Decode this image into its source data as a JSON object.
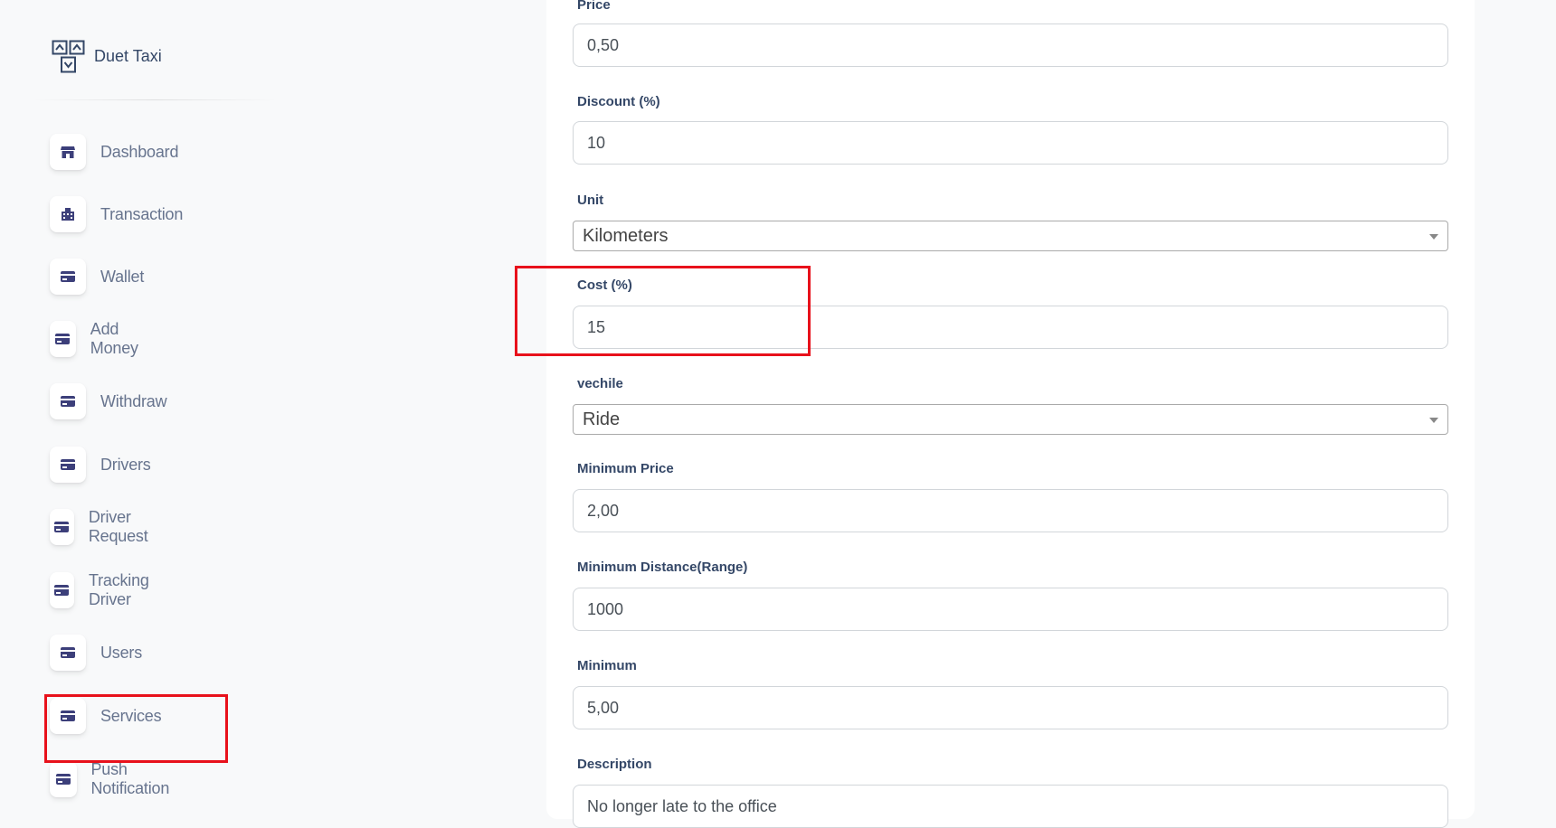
{
  "brand": {
    "name": "Duet Taxi",
    "logo_icon": "duet-logo-icon"
  },
  "sidebar": {
    "items": [
      {
        "label": "Dashboard",
        "icon": "shop-icon"
      },
      {
        "label": "Transaction",
        "icon": "building-icon"
      },
      {
        "label": "Wallet",
        "icon": "card-icon"
      },
      {
        "label": "Add Money",
        "icon": "card-icon"
      },
      {
        "label": "Withdraw",
        "icon": "card-icon"
      },
      {
        "label": "Drivers",
        "icon": "card-icon"
      },
      {
        "label": "Driver Request",
        "icon": "card-icon"
      },
      {
        "label": "Tracking Driver",
        "icon": "card-icon"
      },
      {
        "label": "Users",
        "icon": "card-icon"
      },
      {
        "label": "Services",
        "icon": "card-icon"
      },
      {
        "label": "Push Notification",
        "icon": "card-icon"
      }
    ]
  },
  "form": {
    "price": {
      "label": "Price",
      "value": "0,50"
    },
    "discount": {
      "label": "Discount (%)",
      "value": "10"
    },
    "unit": {
      "label": "Unit",
      "value": "Kilometers"
    },
    "cost": {
      "label": "Cost (%)",
      "value": "15"
    },
    "vehicle": {
      "label": "vechile",
      "value": "Ride"
    },
    "minimum_price": {
      "label": "Minimum Price",
      "value": "2,00"
    },
    "minimum_distance": {
      "label": "Minimum Distance(Range)",
      "value": "1000"
    },
    "minimum": {
      "label": "Minimum",
      "value": "5,00"
    },
    "description": {
      "label": "Description",
      "value": "No longer late to the office"
    }
  },
  "colors": {
    "accent": "#344767",
    "icon": "#3c3f7a",
    "highlight": "#e8111b",
    "nav_text": "#67748e"
  }
}
